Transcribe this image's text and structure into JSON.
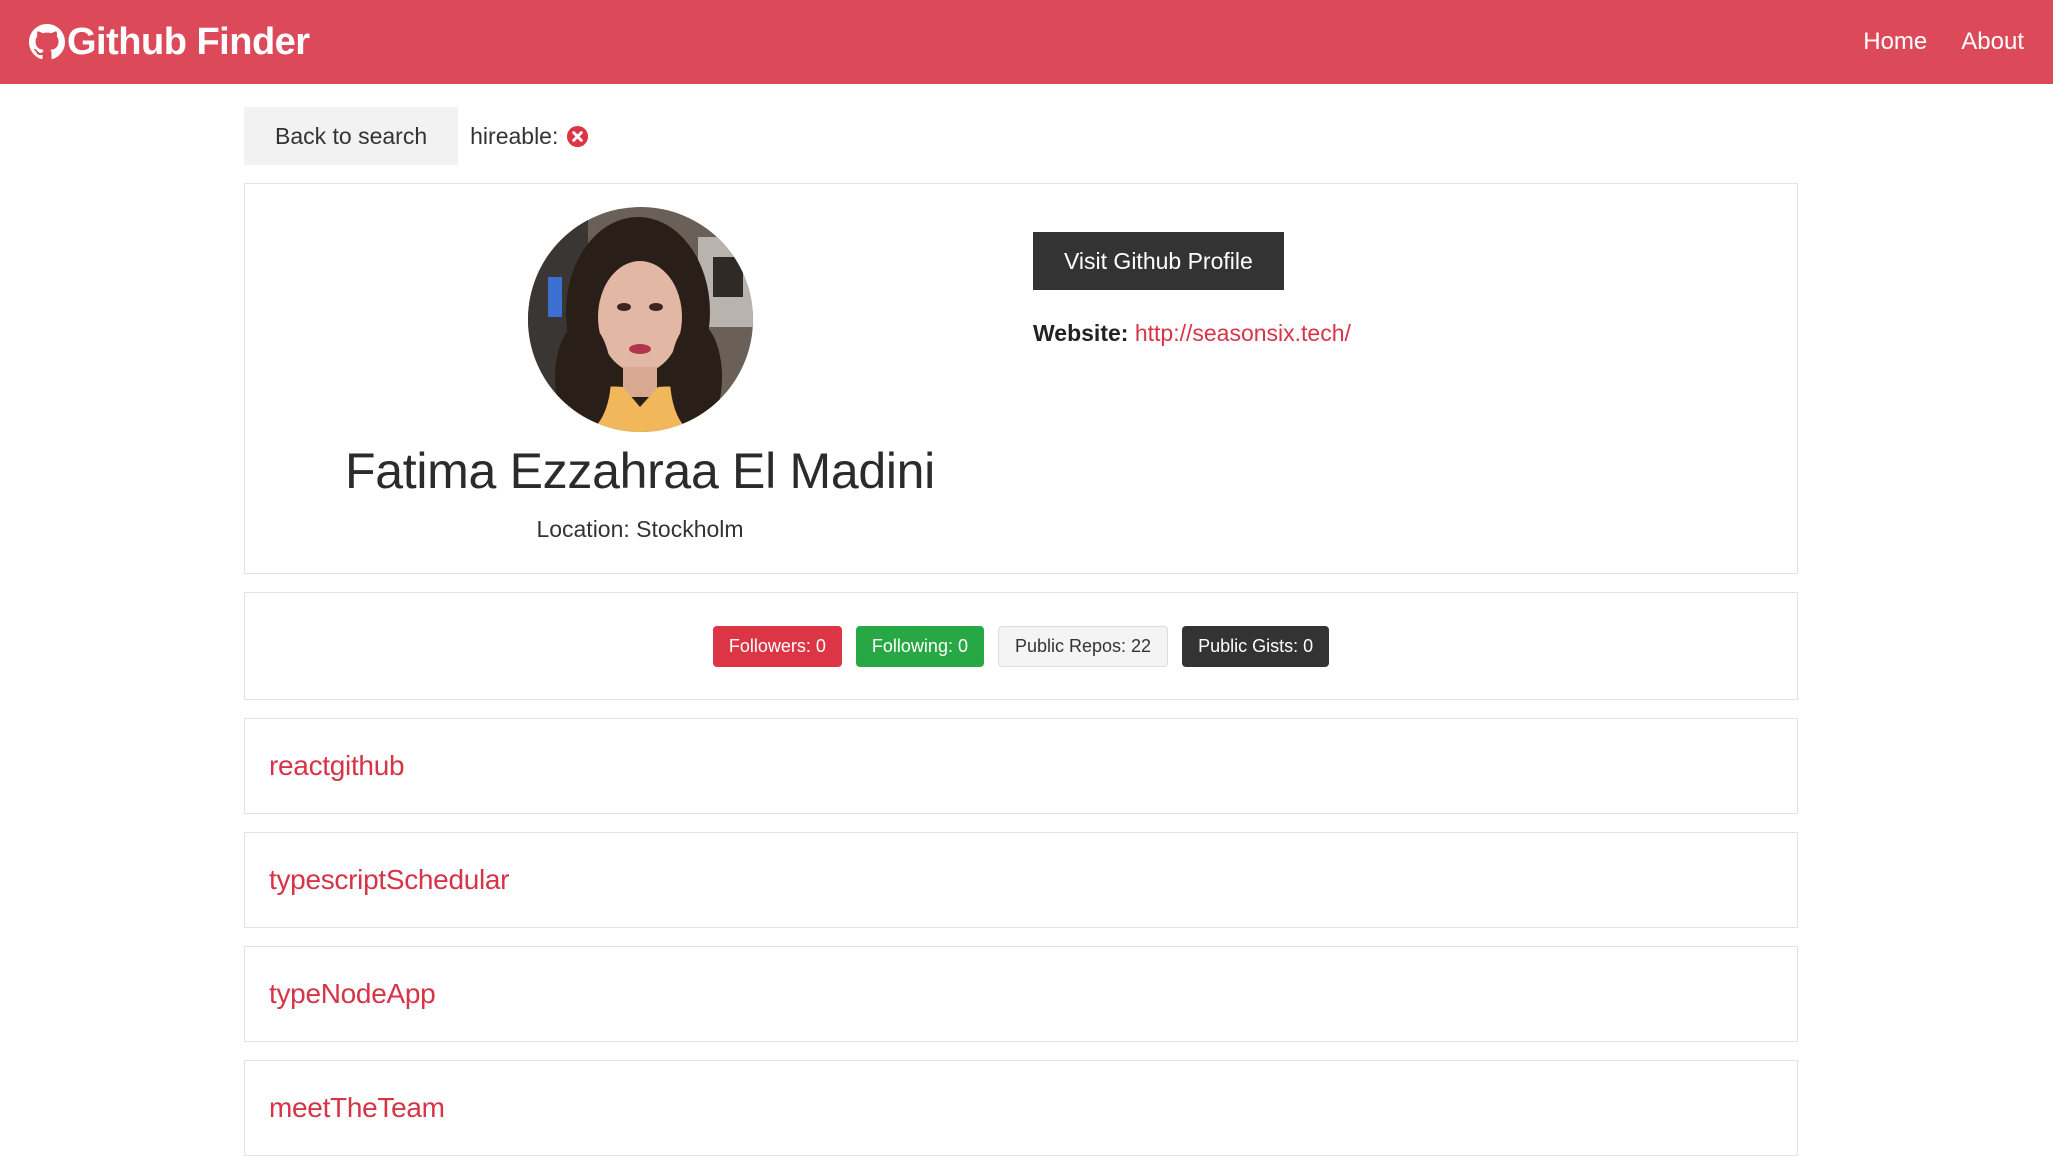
{
  "navbar": {
    "brand": "Github Finder",
    "brand_icon": "github-icon",
    "links": [
      "Home",
      "About"
    ],
    "bg_color": "#dc4a5a"
  },
  "actions": {
    "back_label": "Back to search",
    "hireable_label": "hireable:",
    "hireable_icon": "times-circle-icon"
  },
  "profile": {
    "name": "Fatima Ezzahraa El Madini",
    "location": "Location: Stockholm",
    "visit_label": "Visit Github Profile",
    "website_label": "Website:",
    "website_url": "http://seasonsix.tech/"
  },
  "badges": [
    {
      "label": "Followers: 0",
      "variant": "danger"
    },
    {
      "label": "Following: 0",
      "variant": "success"
    },
    {
      "label": "Public Repos: 22",
      "variant": "light"
    },
    {
      "label": "Public Gists: 0",
      "variant": "dark"
    }
  ],
  "repos": [
    "reactgithub",
    "typescriptSchedular",
    "typeNodeApp",
    "meetTheTeam"
  ]
}
